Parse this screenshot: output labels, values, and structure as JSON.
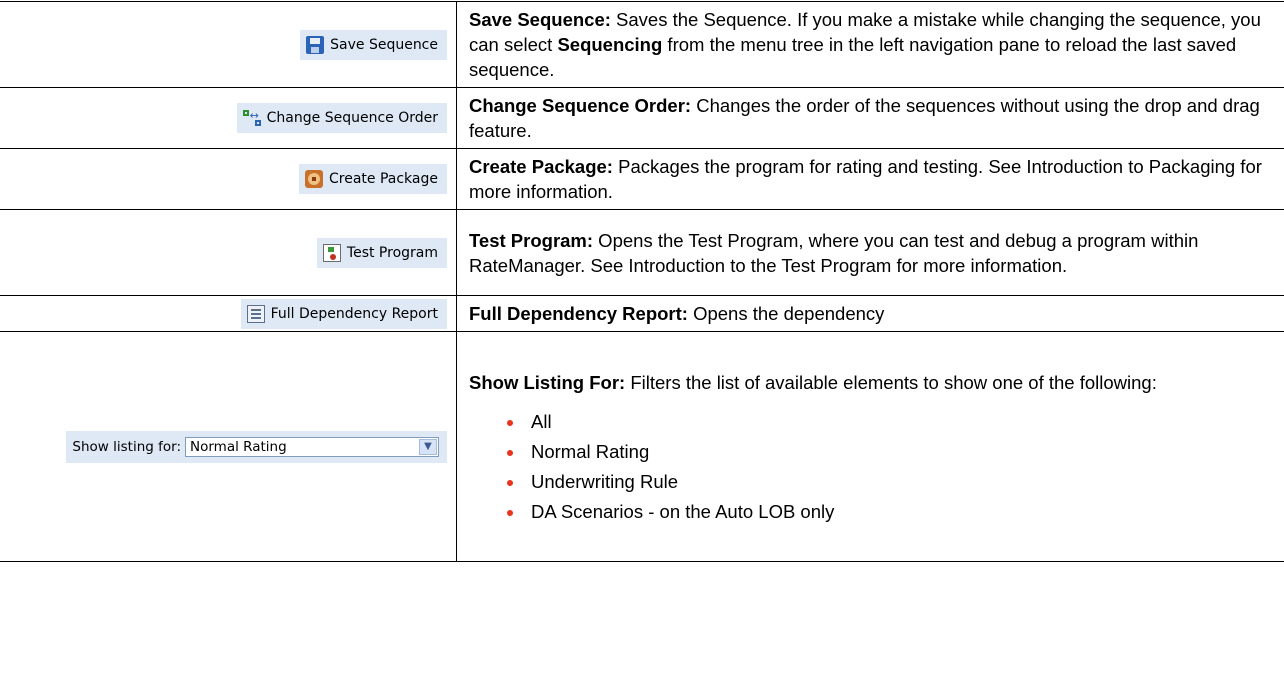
{
  "rows": {
    "save": {
      "button": "Save Sequence",
      "icon": "save-icon",
      "title": "Save Sequence:",
      "text_a": " Saves the Sequence. If you make a mistake while changing the sequence, you can select ",
      "bold": "Sequencing",
      "text_b": " from the menu tree in the left navigation pane to reload the last saved sequence."
    },
    "order": {
      "button": "Change Sequence Order",
      "icon": "change-order-icon",
      "title": "Change Sequence Order:",
      "text": " Changes the order of the sequences without using the drop and drag feature."
    },
    "package": {
      "button": "Create Package",
      "icon": "package-icon",
      "title": "Create Package:",
      "text": " Packages the program for rating and testing. See Introduction to Packaging for more information."
    },
    "test": {
      "button": "Test Program",
      "icon": "test-program-icon",
      "title": "Test Program:",
      "text": " Opens the Test Program, where you can test and debug a program within RateManager. See Introduction to the Test Program for more information."
    },
    "report": {
      "button": "Full Dependency Report",
      "icon": "report-icon",
      "title": "Full Dependency Report:",
      "text": " Opens the dependency"
    },
    "listing": {
      "label": "Show listing for:",
      "selected": "Normal Rating",
      "title": "Show Listing For:",
      "text": " Filters the list of available elements to show one of the following:",
      "options": [
        "All",
        "Normal Rating",
        "Underwriting Rule",
        "DA Scenarios  - on the Auto LOB only"
      ]
    }
  },
  "colors": {
    "button_bg": "#dfe9f6",
    "bullet": "#e8331f"
  }
}
